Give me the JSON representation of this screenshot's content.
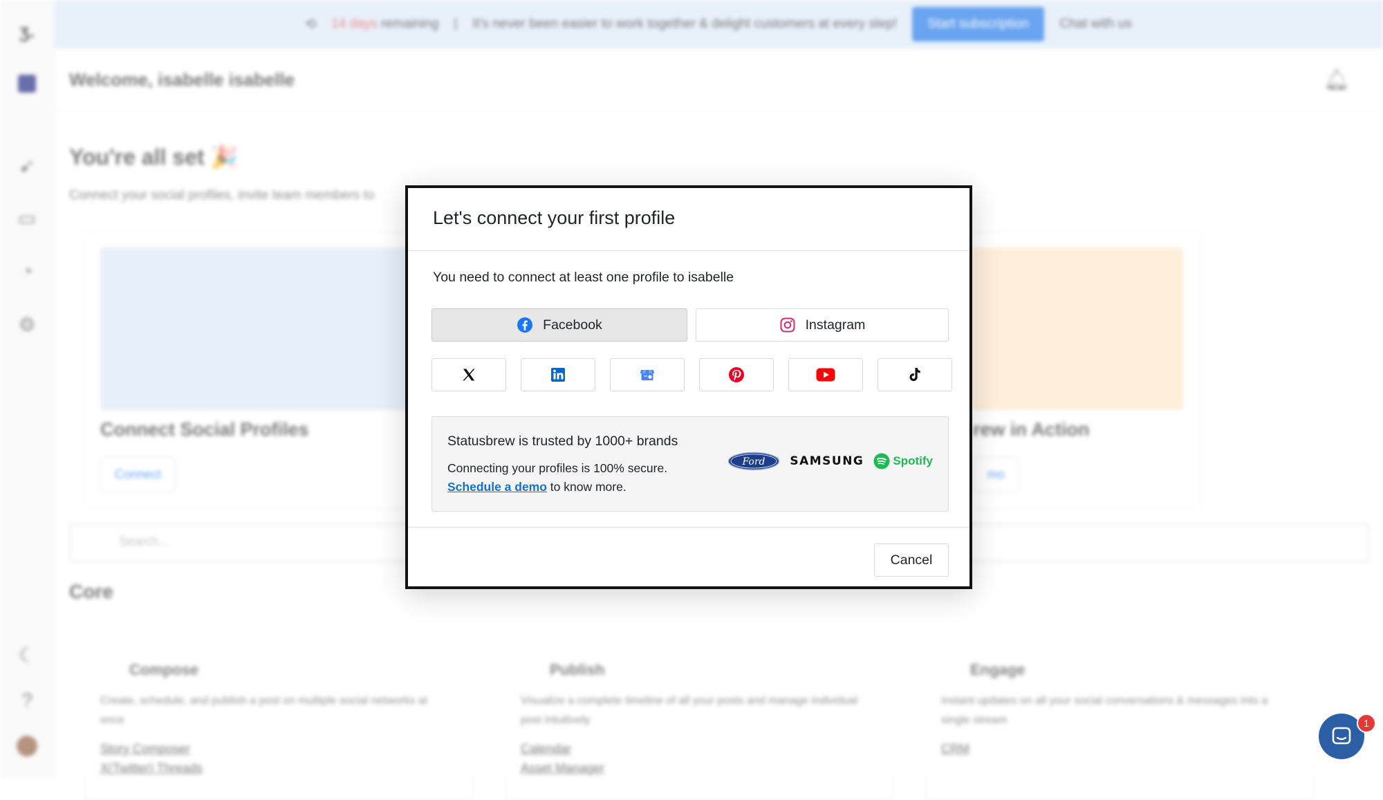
{
  "banner": {
    "days": "14 days",
    "remaining": "remaining",
    "separator": "|",
    "message": "It's never been easier to work together & delight customers at every step!",
    "subscribe_label": "Start subscription",
    "chat_label": "Chat with us"
  },
  "header": {
    "welcome": "Welcome, isabelle isabelle"
  },
  "main": {
    "title": "You're all set 🎉",
    "subtitle": "Connect your social profiles, invite team members to",
    "cards": [
      {
        "title": "Connect Social Profiles",
        "button": "Connect"
      },
      {
        "title": "rew in Action",
        "button": "mo"
      }
    ],
    "search_placeholder": "Search...",
    "section": "Core",
    "core_cards": [
      {
        "title": "Compose",
        "desc": "Create, schedule, and publish a post on multiple social networks at once",
        "links": [
          "Story Composer",
          "X(Twitter) Threads"
        ]
      },
      {
        "title": "Publish",
        "desc": "Visualize a complete timeline of all your posts and manage individual post intuitively",
        "links": [
          "Calendar",
          "Asset Manager"
        ]
      },
      {
        "title": "Engage",
        "desc": "Instant updates on all your social conversations & messages into a single stream",
        "links": [
          "CRM"
        ]
      }
    ]
  },
  "chat_badge": "1",
  "modal": {
    "title": "Let's connect your first profile",
    "text": "You need to connect at least one profile to isabelle",
    "primary": [
      {
        "label": "Facebook",
        "icon": "facebook-icon"
      },
      {
        "label": "Instagram",
        "icon": "instagram-icon"
      }
    ],
    "secondary": [
      "x-icon",
      "linkedin-icon",
      "google-business-icon",
      "pinterest-icon",
      "youtube-icon",
      "tiktok-icon"
    ],
    "trust": {
      "heading": "Statusbrew is trusted by 1000+ brands",
      "line1": "Connecting your profiles is 100% secure.",
      "link": "Schedule a demo",
      "line2_rest": " to know more.",
      "brands": [
        "Ford",
        "SAMSUNG",
        "Spotify"
      ]
    },
    "cancel_label": "Cancel"
  },
  "colors": {
    "accent": "#1a73e8",
    "facebook": "#1877f2",
    "pinterest": "#e60023",
    "youtube": "#ff0000",
    "spotify": "#1db954",
    "ford": "#1c3d8c"
  }
}
